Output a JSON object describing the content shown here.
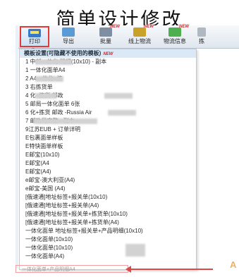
{
  "headline": "简单设计修改",
  "toolbar": {
    "print_label": "打印",
    "buttons": [
      {
        "label": "导出",
        "icon": "export-icon",
        "new": ""
      },
      {
        "label": "批量",
        "icon": "batch-icon",
        "new": "NEW"
      },
      {
        "label": "线上物流",
        "icon": "online-logistics-icon",
        "new": "NEW"
      },
      {
        "label": "物流信息",
        "icon": "logistics-info-icon",
        "new": "NEW"
      },
      {
        "label": "拣",
        "icon": "pick-icon",
        "new": ""
      }
    ]
  },
  "menu": {
    "header": "模板设置(可隐藏不使用的模板)",
    "header_badge": "NEW",
    "items": [
      "1          中邮一体化        明细(10x10) - 副本",
      "1          一体化面单A4",
      "2          A4一体化+拣",
      "3          右拣货单",
      "4      化+拣货 邮政",
      "5          邮局一体化面单        6张",
      "6      化+拣货 邮政                 -Russia Air",
      "7                    邮政局完整 - 副本",
      "9江苏EUB + 订单详明",
      "E包裹面单样板",
      "E特快面单样板",
      "E邮宝(10x10)",
      "E邮宝(A4",
      "E邮宝(A4)",
      "e邮宝-澳大利亚(A4)",
      "e邮宝-美国 (A4)",
      "[俄速通]地址标签+报关单(10x10)",
      "[俄速通]地址标签+报关单(A4)",
      "[俄速通]地址标签+报关单+拣货单(10x10)",
      "[俄速通]地址标签+报关单+拣货单(A4)",
      "一体化面单 地址标签+报关单+产品明细(10x10)",
      "一体化面单(10x10)",
      "一体化面单(10x10)",
      "一体化面单(A4)"
    ],
    "last_item": "一体化面单+产品明细A4"
  },
  "annotation_letter": "A",
  "colors": {
    "highlight": "#e53935",
    "header_bg": "#dbe8f6",
    "new_badge": "#e02020"
  }
}
